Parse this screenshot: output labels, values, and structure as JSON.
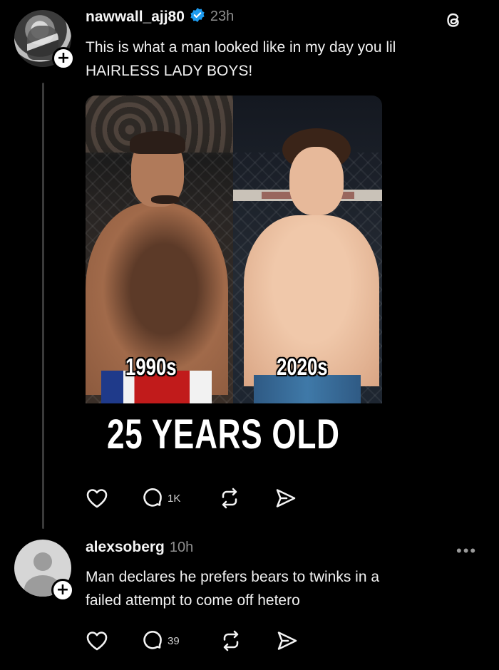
{
  "post": {
    "username": "nawwall_ajj80",
    "verified_icon": "verified-badge-icon",
    "time": "23h",
    "text_line1": "This is what a man looked like in my day you lil",
    "text_line2": "HAIRLESS LADY BOYS!",
    "image": {
      "left_label": "1990s",
      "right_label": "2020s",
      "headline": "25 YEARS OLD"
    },
    "actions": {
      "like_icon": "heart-icon",
      "reply_icon": "comment-icon",
      "reply_count": "1K",
      "repost_icon": "repost-icon",
      "share_icon": "share-icon"
    }
  },
  "reply": {
    "username": "alexsoberg",
    "time": "10h",
    "text_line1": "Man declares he prefers bears to twinks in a",
    "text_line2": "failed attempt to come off hetero",
    "more_label": "•••",
    "actions": {
      "like_icon": "heart-icon",
      "reply_icon": "comment-icon",
      "reply_count": "39",
      "repost_icon": "repost-icon",
      "share_icon": "share-icon"
    }
  },
  "app": {
    "logo_icon": "threads-logo-icon"
  }
}
